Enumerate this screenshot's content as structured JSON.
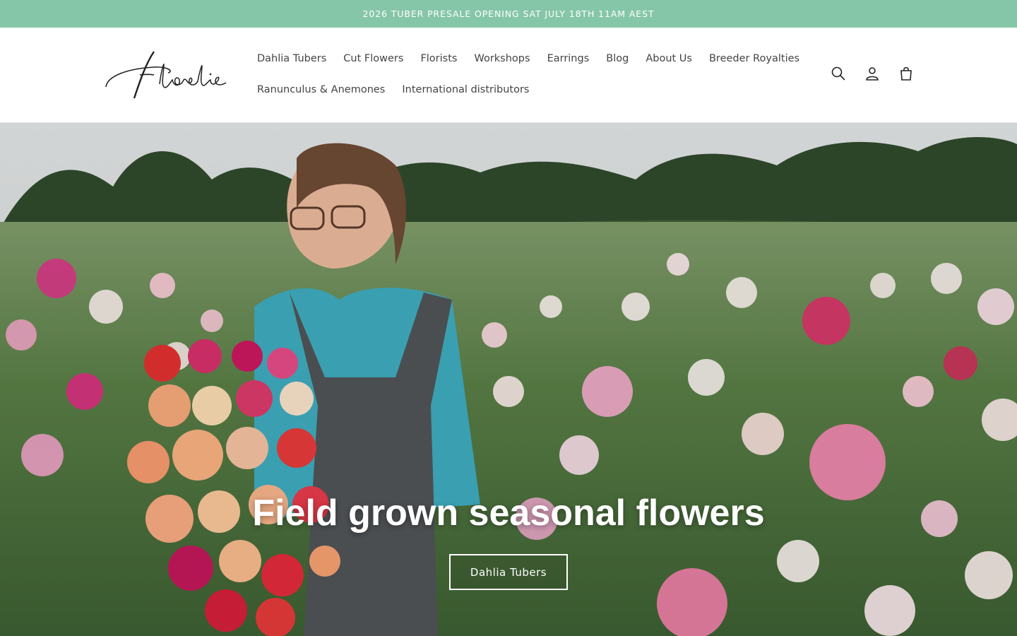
{
  "announcement": "2026 TUBER PRESALE OPENING SAT JULY 18TH 11AM AEST",
  "brand": {
    "logo_text": "Florelie"
  },
  "nav": {
    "row1": [
      "Dahlia Tubers",
      "Cut Flowers",
      "Florists",
      "Workshops",
      "Earrings",
      "Blog",
      "About Us",
      "Breeder Royalties"
    ],
    "row2": [
      "Ranunculus & Anemones",
      "International distributors"
    ]
  },
  "icons": {
    "search": "search-icon",
    "account": "account-icon",
    "cart": "cart-icon"
  },
  "hero": {
    "title": "Field grown seasonal flowers",
    "button_label": "Dahlia Tubers"
  },
  "colors": {
    "announcement_bg": "#86c6a8",
    "header_bg": "#ffffff"
  }
}
